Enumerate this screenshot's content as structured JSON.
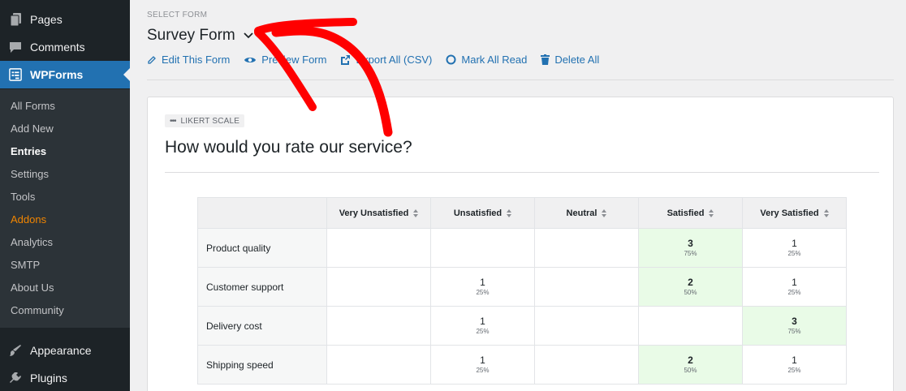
{
  "sidebar": {
    "top_items": [
      {
        "label": "Pages",
        "icon": "pages-icon"
      },
      {
        "label": "Comments",
        "icon": "comments-icon"
      }
    ],
    "active_item": {
      "label": "WPForms",
      "icon": "wpforms-icon"
    },
    "submenu": [
      "All Forms",
      "Add New",
      "Entries",
      "Settings",
      "Tools",
      "Addons",
      "Analytics",
      "SMTP",
      "About Us",
      "Community"
    ],
    "bottom_items": [
      {
        "label": "Appearance",
        "icon": "appearance-icon"
      },
      {
        "label": "Plugins",
        "icon": "plugins-icon"
      }
    ],
    "current_submenu": "Entries",
    "highlight_submenu": "Addons",
    "colors": {
      "bg": "#1d2327",
      "active": "#2271b1",
      "addons": "#f18500"
    }
  },
  "header": {
    "select_label": "SELECT FORM",
    "form_name": "Survey Form",
    "actions": [
      {
        "label": "Edit This Form",
        "icon": "pencil-icon"
      },
      {
        "label": "Preview Form",
        "icon": "eye-icon"
      },
      {
        "label": "Export All (CSV)",
        "icon": "export-icon"
      },
      {
        "label": "Mark All Read",
        "icon": "circle-icon"
      },
      {
        "label": "Delete All",
        "icon": "trash-icon"
      }
    ]
  },
  "card": {
    "field_type": "LIKERT SCALE",
    "question": "How would you rate our service?",
    "columns": [
      "Very Unsatisfied",
      "Unsatisfied",
      "Neutral",
      "Satisfied",
      "Very Satisfied"
    ],
    "rows": [
      {
        "label": "Product quality",
        "cells": [
          null,
          null,
          null,
          {
            "count": "3",
            "pct": "75%",
            "top": true
          },
          {
            "count": "1",
            "pct": "25%"
          }
        ]
      },
      {
        "label": "Customer support",
        "cells": [
          null,
          {
            "count": "1",
            "pct": "25%"
          },
          null,
          {
            "count": "2",
            "pct": "50%",
            "top": true
          },
          {
            "count": "1",
            "pct": "25%"
          }
        ]
      },
      {
        "label": "Delivery cost",
        "cells": [
          null,
          {
            "count": "1",
            "pct": "25%"
          },
          null,
          null,
          {
            "count": "3",
            "pct": "75%",
            "top": true
          }
        ]
      },
      {
        "label": "Shipping speed",
        "cells": [
          null,
          {
            "count": "1",
            "pct": "25%"
          },
          null,
          {
            "count": "2",
            "pct": "50%",
            "top": true
          },
          {
            "count": "1",
            "pct": "25%"
          }
        ]
      }
    ],
    "highlight_color": "#e9fbe7"
  },
  "annotation": {
    "color": "#ff0000"
  }
}
